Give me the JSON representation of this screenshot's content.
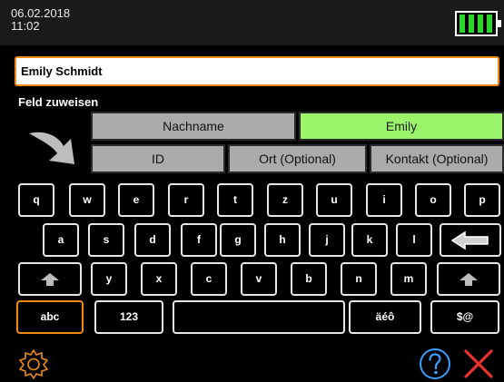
{
  "status": {
    "date": "06.02.2018",
    "time": "11:02"
  },
  "name_input": {
    "value": "Emily Schmidt"
  },
  "assign": {
    "label": "Feld zuweisen",
    "fields": {
      "nachname": "Nachname",
      "vorname_value": "Emily",
      "id": "ID",
      "ort": "Ort (Optional)",
      "kontakt": "Kontakt (Optional)"
    }
  },
  "keyboard": {
    "row1": [
      "q",
      "w",
      "e",
      "r",
      "t",
      "z",
      "u",
      "i",
      "o",
      "p"
    ],
    "row2": [
      "a",
      "s",
      "d",
      "f",
      "g",
      "h",
      "j",
      "k",
      "l"
    ],
    "row3": [
      "y",
      "x",
      "c",
      "v",
      "b",
      "n",
      "m"
    ],
    "row4": {
      "abc": "abc",
      "num": "123",
      "accents": "äéô",
      "symbols": "$@"
    }
  },
  "colors": {
    "accent": "#f08a17",
    "active_field": "#9bf56a",
    "field": "#ababab",
    "battery": "#2bd52b"
  },
  "icons": [
    "battery-icon",
    "arrow-icon",
    "backspace-icon",
    "shift-icon",
    "settings-gear-icon",
    "help-icon",
    "close-icon"
  ]
}
